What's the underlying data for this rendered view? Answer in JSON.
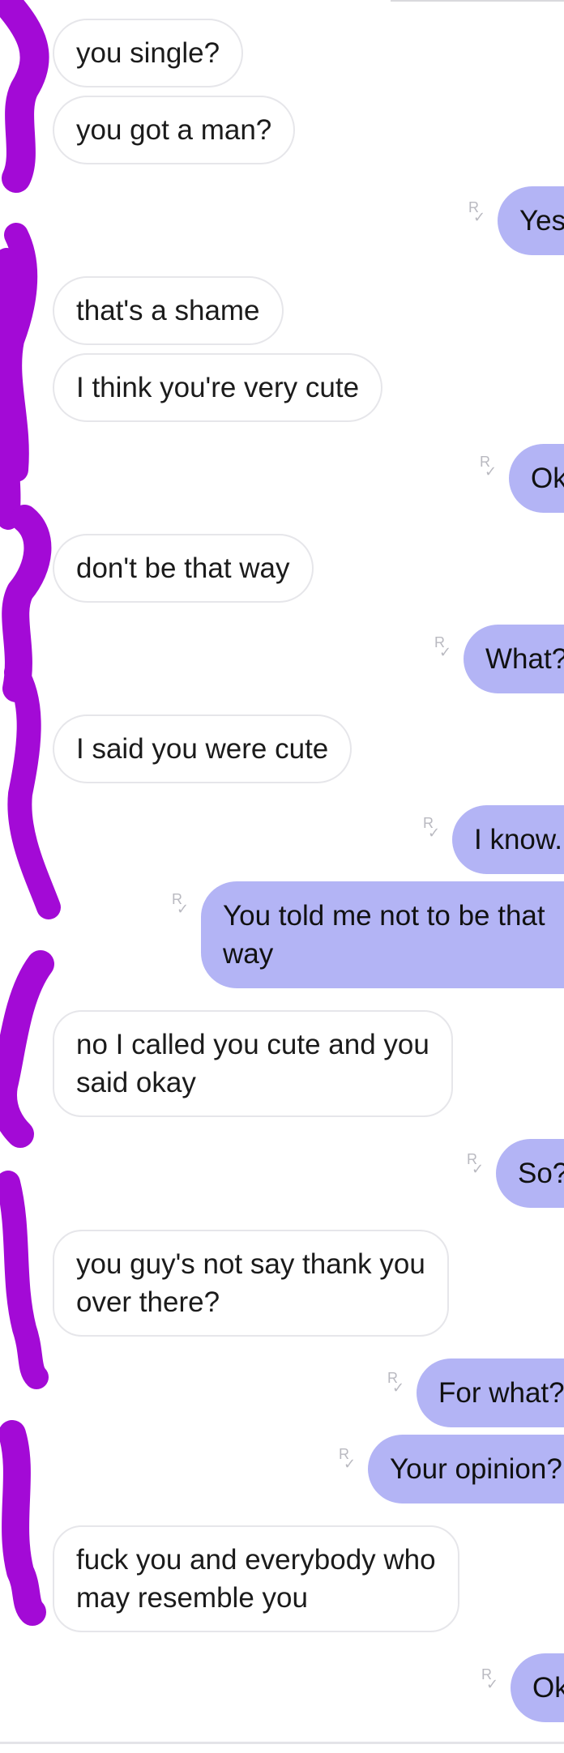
{
  "conversation": {
    "messages": [
      {
        "side": "in",
        "text": "you single?"
      },
      {
        "side": "in",
        "text": "you got a man?"
      },
      {
        "side": "out",
        "text": "Yes"
      },
      {
        "side": "in",
        "text": "that's a shame"
      },
      {
        "side": "in",
        "text": "I think you're very cute"
      },
      {
        "side": "out",
        "text": "Ok"
      },
      {
        "side": "in",
        "text": "don't be that way"
      },
      {
        "side": "out",
        "text": "What?"
      },
      {
        "side": "in",
        "text": "I said you were cute"
      },
      {
        "side": "out",
        "text": "I know."
      },
      {
        "side": "out",
        "text": "You told me not to be that\nway"
      },
      {
        "side": "in",
        "text": "no I called you cute and you\nsaid okay"
      },
      {
        "side": "out",
        "text": "So?"
      },
      {
        "side": "in",
        "text": "you guy's not say thank you\nover there?"
      },
      {
        "side": "out",
        "text": "For what?"
      },
      {
        "side": "out",
        "text": "Your opinion?"
      },
      {
        "side": "in",
        "text": "fuck you and everybody who\nmay resemble you"
      },
      {
        "side": "out",
        "text": "Ok"
      }
    ]
  },
  "theme": {
    "incoming_bubble": "#ffffff",
    "outgoing_bubble": "#b3b4f5",
    "redaction_marker": "#a30ad6"
  },
  "receipt_icon": "read-receipt-icon"
}
